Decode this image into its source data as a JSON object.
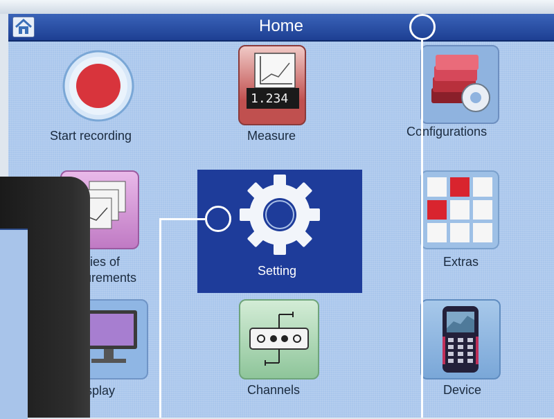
{
  "header": {
    "title": "Home",
    "home_icon": "home-icon"
  },
  "tiles": {
    "start_recording": {
      "label": "Start recording",
      "icon": "record-icon"
    },
    "measure": {
      "label": "Measure",
      "icon": "measure-chart-icon",
      "value": "1.234"
    },
    "configurations": {
      "label": "Configurations",
      "icon": "configurations-icon"
    },
    "series": {
      "label_line1": "ries of",
      "label_line2": "urements",
      "icon": "series-charts-icon"
    },
    "setting": {
      "label": "Setting",
      "icon": "gear-icon",
      "selected": true
    },
    "extras": {
      "label": "Extras",
      "icon": "grid-icon"
    },
    "display": {
      "label": "isplay",
      "icon": "monitor-icon"
    },
    "channels": {
      "label": "Channels",
      "icon": "channels-icon"
    },
    "device": {
      "label": "Device",
      "icon": "device-icon"
    }
  },
  "colors": {
    "titlebar": "#1d3f93",
    "screen_bg": "#a9c6ec",
    "selected_tile": "#1e3c9a",
    "record": "#d8343c",
    "annotation": "#ffffff"
  }
}
